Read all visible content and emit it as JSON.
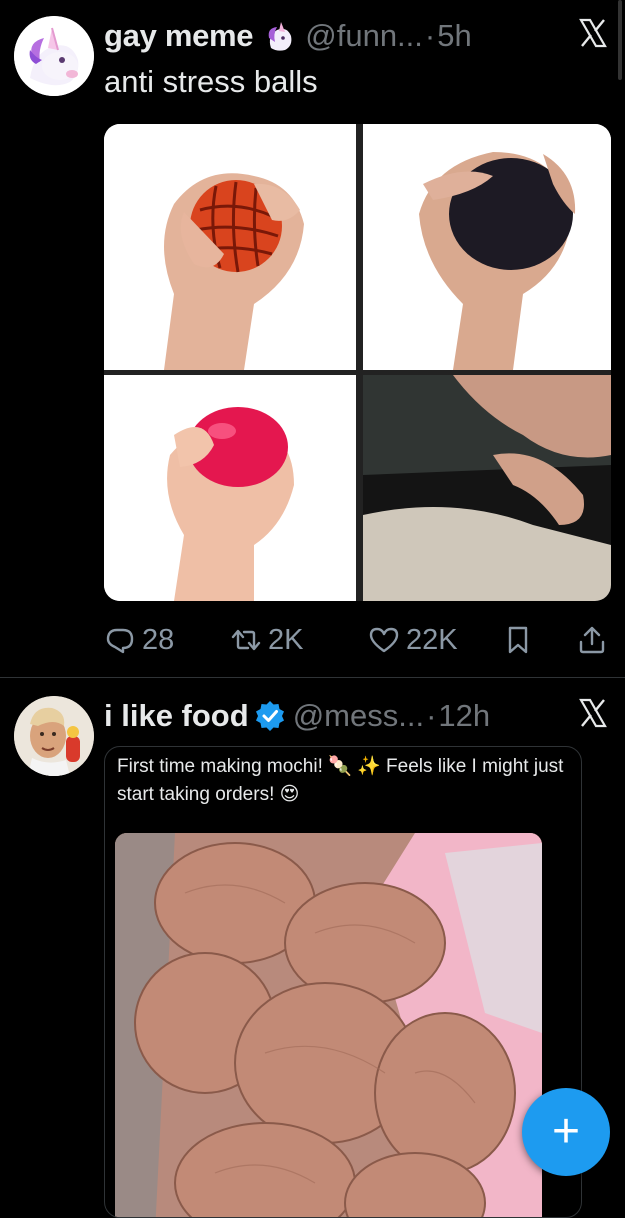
{
  "tweets": [
    {
      "name": "gay meme",
      "name_emoji": "unicorn-emoji",
      "handle": "@funn...",
      "separator": "·",
      "time": "5h",
      "text": "anti stress balls",
      "actions": {
        "replies": "28",
        "retweets": "2K",
        "likes": "22K"
      }
    },
    {
      "name": "i like food",
      "verified": true,
      "handle": "@mess...",
      "separator": "·",
      "time": "12h",
      "quote_text": "First time making mochi! 🍡 ✨ Feels like I might just start taking orders! 😍"
    }
  ],
  "colors": {
    "accent": "#1d9bf0",
    "muted": "#71767b",
    "background": "#000000",
    "text": "#e7e9ea"
  },
  "fab": {
    "label": "+"
  }
}
